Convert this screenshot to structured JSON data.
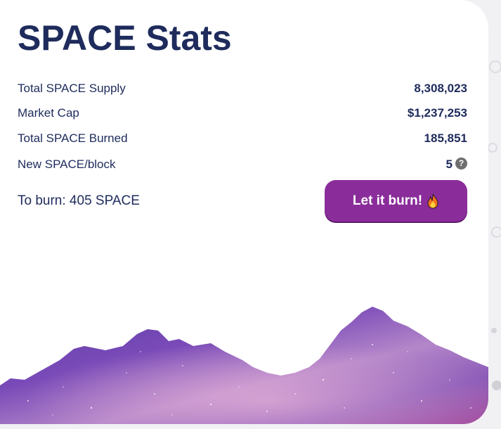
{
  "widget": {
    "title": "SPACE Stats"
  },
  "stats": [
    {
      "label": "Total SPACE Supply",
      "value": "8,308,023"
    },
    {
      "label": "Market Cap",
      "value": "$1,237,253"
    },
    {
      "label": "Total SPACE Burned",
      "value": "185,851"
    },
    {
      "label": "New SPACE/block",
      "value": "5"
    }
  ],
  "burn": {
    "to_burn_text": "To burn: 405 SPACE",
    "button_label": "Let it burn!",
    "button_icon": "fire-icon"
  },
  "icons": {
    "help": "question-circle-icon",
    "help_glyph": "?"
  },
  "colors": {
    "title": "#1e2b5c",
    "text": "#1e2b5c",
    "button": "#8a2d9a",
    "help_icon": "#6e6e6e"
  }
}
